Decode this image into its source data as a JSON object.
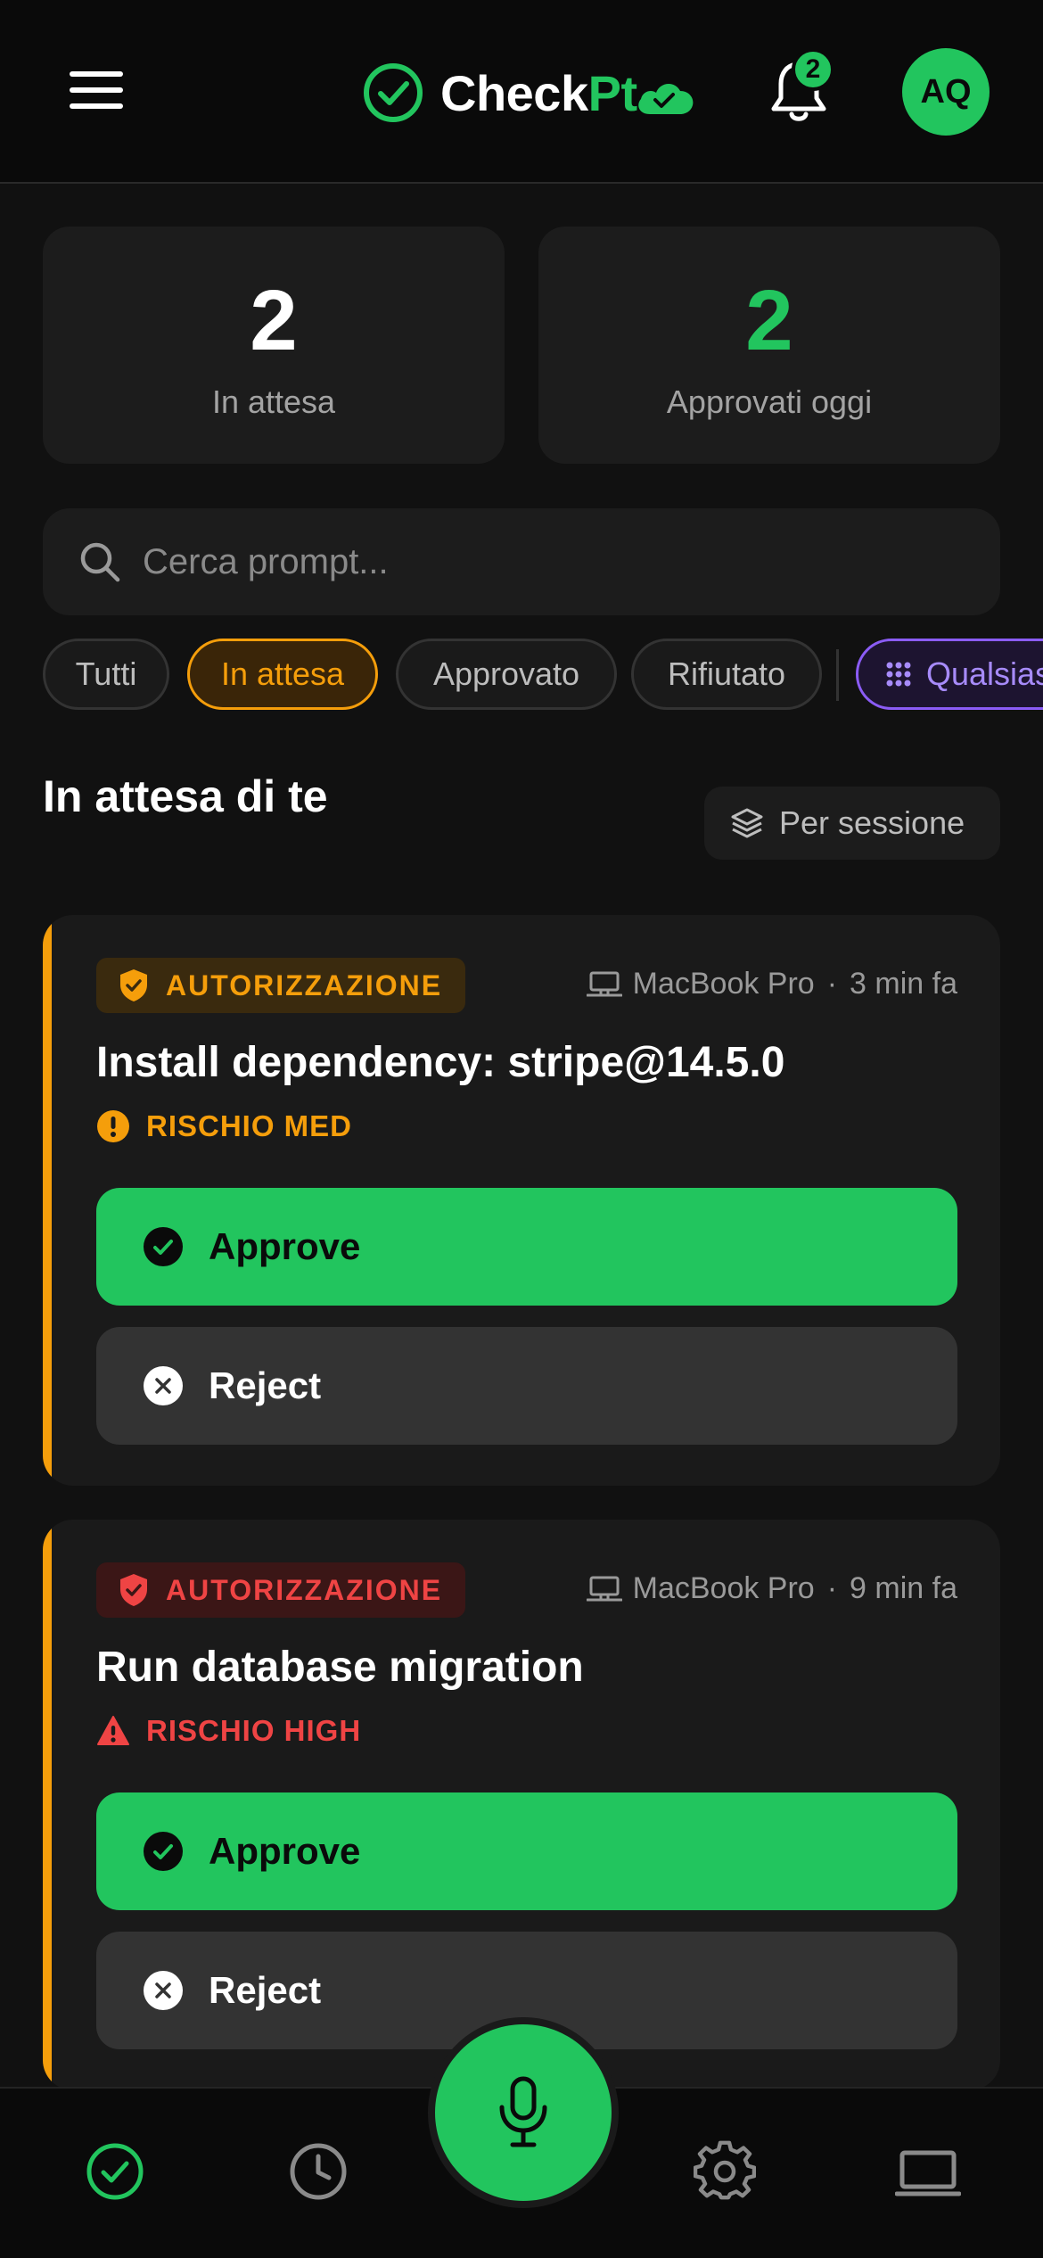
{
  "app": {
    "name_part1": "Check",
    "name_part2": "Pt",
    "notification_count": "2",
    "avatar_initials": "AQ",
    "brand_color": "#22c55e"
  },
  "stats": {
    "pending": {
      "value": "2",
      "label": "In attesa"
    },
    "approved_today": {
      "value": "2",
      "label": "Approvati oggi"
    }
  },
  "search": {
    "placeholder": "Cerca prompt...",
    "value": ""
  },
  "filters": {
    "items": [
      "Tutti",
      "In attesa",
      "Approvato",
      "Rifiutato"
    ],
    "active": "In attesa",
    "extra": "Qualsiasi"
  },
  "section": {
    "title": "In attesa di te",
    "group_button": "Per sessione"
  },
  "requests": [
    {
      "tag": "AUTORIZZAZIONE",
      "device": "MacBook Pro",
      "time": "3 min fa",
      "title": "Install dependency: stripe@14.5.0",
      "risk": "RISCHIO MED",
      "risk_color": "#f59e0b",
      "approve_label": "Approve",
      "reject_label": "Reject"
    },
    {
      "tag": "AUTORIZZAZIONE",
      "device": "MacBook Pro",
      "time": "9 min fa",
      "title": "Run database migration",
      "risk": "RISCHIO HIGH",
      "risk_color": "#ef4444",
      "approve_label": "Approve",
      "reject_label": "Reject"
    }
  ],
  "meta_separator": "·",
  "tabbar": {
    "tabs": [
      "approvals-icon",
      "history-icon",
      "microphone-icon",
      "settings-icon",
      "devices-icon"
    ]
  }
}
